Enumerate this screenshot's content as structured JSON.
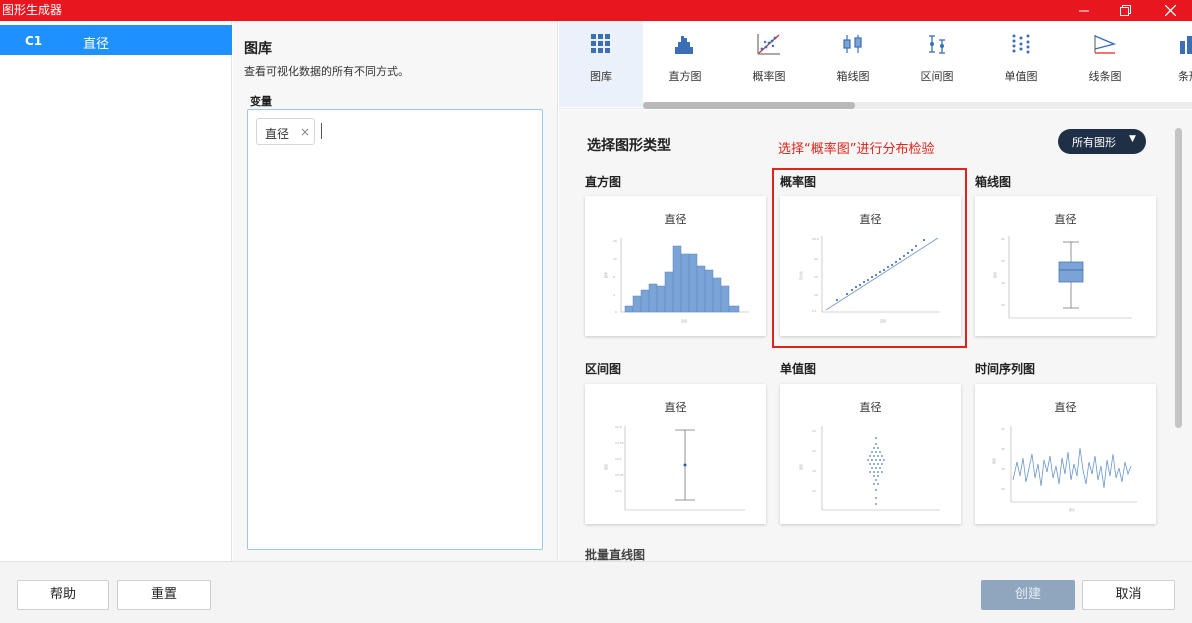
{
  "window": {
    "title": "图形生成器"
  },
  "columns": [
    {
      "id": "C1",
      "name": "直径"
    }
  ],
  "gallery_panel": {
    "heading": "图库",
    "description": "查看可视化数据的所有不同方式。",
    "variable_label": "变量",
    "selected_variable": "直径",
    "chip_remove_glyph": "×"
  },
  "tabs": [
    {
      "label": "图库",
      "icon": "grid-icon",
      "active": true
    },
    {
      "label": "直方图",
      "icon": "histogram-icon"
    },
    {
      "label": "概率图",
      "icon": "probability-plot-icon"
    },
    {
      "label": "箱线图",
      "icon": "boxplot-icon"
    },
    {
      "label": "区间图",
      "icon": "interval-plot-icon"
    },
    {
      "label": "单值图",
      "icon": "individual-value-icon"
    },
    {
      "label": "线条图",
      "icon": "line-plot-icon"
    },
    {
      "label": "条形",
      "icon": "bar-chart-icon"
    }
  ],
  "content": {
    "section_title": "选择图形类型",
    "annotation": "选择“概率图”进行分布检验",
    "filter_button": "所有图形",
    "filter_chevron": "▼",
    "cutoff_title": "批量直线图"
  },
  "graphs": [
    {
      "type": "直方图",
      "card_title": "直径"
    },
    {
      "type": "概率图",
      "card_title": "直径"
    },
    {
      "type": "箱线图",
      "card_title": "直径"
    },
    {
      "type": "区间图",
      "card_title": "直径"
    },
    {
      "type": "单值图",
      "card_title": "直径"
    },
    {
      "type": "时间序列图",
      "card_title": "直径"
    }
  ],
  "footer": {
    "help": "帮助",
    "reset": "重置",
    "create": "创建",
    "cancel": "取消"
  },
  "colors": {
    "titlebar": "#e8161f",
    "accent": "#1e90ff",
    "chart_fill": "#7ba3d6",
    "annotation": "#e2231a",
    "filter_button": "#1f2f45"
  }
}
